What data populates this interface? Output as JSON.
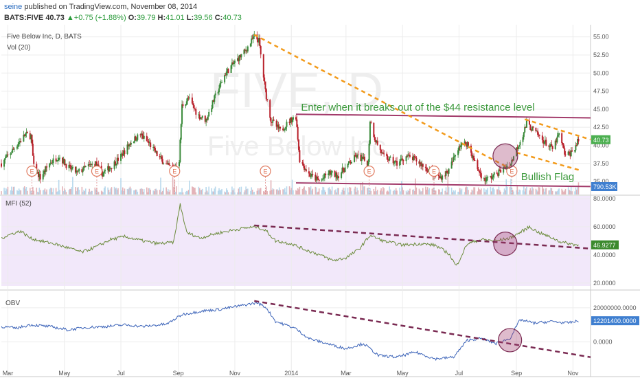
{
  "header": {
    "user": "seine",
    "published_text": "published on TradingView.com, November 08, 2014",
    "symbol": "BATS:FIVE",
    "price": "40.73",
    "change_arrow": "▲",
    "change": "+0.75 (+1.88%)",
    "ohlc": [
      {
        "label": "O:",
        "value": "39.79"
      },
      {
        "label": "H:",
        "value": "41.01"
      },
      {
        "label": "L:",
        "value": "39.56"
      },
      {
        "label": "C:",
        "value": "40.73"
      }
    ]
  },
  "chart_data": [
    {
      "type": "candlestick",
      "title": "Five Below Inc, D, BATS",
      "subtitle": "Vol (20)",
      "watermark": "FIVE, D",
      "watermark_sub": "Five Below Inc",
      "ylim": [
        33.2,
        56.3
      ],
      "y_ticks": [
        "55.00",
        "52.50",
        "50.00",
        "47.50",
        "45.00",
        "42.50",
        "40.00",
        "37.50",
        "35.00"
      ],
      "last_price_label": "40.73",
      "volume_label": "790.53K",
      "earnings_marker": "E",
      "earnings_dates": [
        "2013-03-27",
        "2013-06-05",
        "2013-08-28",
        "2013-12-04",
        "2014-03-26",
        "2014-06-04",
        "2014-08-27"
      ],
      "price_path": [
        [
          "2013-02-22",
          37.5
        ],
        [
          "2013-03-01",
          38.5
        ],
        [
          "2013-03-12",
          40.3
        ],
        [
          "2013-03-20",
          41.5
        ],
        [
          "2013-03-26",
          41.3
        ],
        [
          "2013-03-29",
          37.0
        ],
        [
          "2013-04-05",
          35.5
        ],
        [
          "2013-04-15",
          37.5
        ],
        [
          "2013-04-25",
          38.5
        ],
        [
          "2013-05-05",
          37.0
        ],
        [
          "2013-05-15",
          36.2
        ],
        [
          "2013-05-25",
          37.0
        ],
        [
          "2013-06-04",
          37.5
        ],
        [
          "2013-06-10",
          36.0
        ],
        [
          "2013-06-20",
          37.0
        ],
        [
          "2013-07-01",
          38.5
        ],
        [
          "2013-07-12",
          40.5
        ],
        [
          "2013-07-22",
          41.5
        ],
        [
          "2013-08-01",
          40.2
        ],
        [
          "2013-08-10",
          38.5
        ],
        [
          "2013-08-20",
          37.2
        ],
        [
          "2013-08-27",
          36.8
        ],
        [
          "2013-09-02",
          38.0
        ],
        [
          "2013-09-05",
          45.5
        ],
        [
          "2013-09-12",
          46.5
        ],
        [
          "2013-09-22",
          44.2
        ],
        [
          "2013-10-01",
          43.5
        ],
        [
          "2013-10-10",
          46.5
        ],
        [
          "2013-10-22",
          50.0
        ],
        [
          "2013-11-01",
          51.5
        ],
        [
          "2013-11-12",
          53.0
        ],
        [
          "2013-11-22",
          55.0
        ],
        [
          "2013-11-27",
          54.5
        ],
        [
          "2013-12-04",
          47.5
        ],
        [
          "2013-12-10",
          43.5
        ],
        [
          "2013-12-20",
          42.0
        ],
        [
          "2013-12-31",
          43.5
        ],
        [
          "2014-01-06",
          44.0
        ],
        [
          "2014-01-10",
          38.0
        ],
        [
          "2014-01-20",
          36.0
        ],
        [
          "2014-02-01",
          35.0
        ],
        [
          "2014-02-10",
          36.2
        ],
        [
          "2014-02-20",
          35.8
        ],
        [
          "2014-03-01",
          37.0
        ],
        [
          "2014-03-12",
          38.5
        ],
        [
          "2014-03-20",
          38.0
        ],
        [
          "2014-03-25",
          37.5
        ],
        [
          "2014-03-27",
          43.5
        ],
        [
          "2014-04-01",
          41.0
        ],
        [
          "2014-04-10",
          38.5
        ],
        [
          "2014-04-25",
          37.5
        ],
        [
          "2014-05-05",
          38.5
        ],
        [
          "2014-05-15",
          38.0
        ],
        [
          "2014-05-25",
          37.0
        ],
        [
          "2014-06-04",
          36.0
        ],
        [
          "2014-06-10",
          35.5
        ],
        [
          "2014-06-20",
          36.5
        ],
        [
          "2014-07-01",
          40.0
        ],
        [
          "2014-07-10",
          40.3
        ],
        [
          "2014-07-20",
          37.0
        ],
        [
          "2014-07-28",
          35.2
        ],
        [
          "2014-08-05",
          35.6
        ],
        [
          "2014-08-15",
          36.5
        ],
        [
          "2014-08-26",
          37.5
        ],
        [
          "2014-09-01",
          39.5
        ],
        [
          "2014-09-08",
          41.5
        ],
        [
          "2014-09-12",
          43.0
        ],
        [
          "2014-09-20",
          42.0
        ],
        [
          "2014-10-01",
          40.5
        ],
        [
          "2014-10-10",
          39.5
        ],
        [
          "2014-10-17",
          41.5
        ],
        [
          "2014-10-24",
          38.5
        ],
        [
          "2014-11-01",
          39.2
        ],
        [
          "2014-11-07",
          40.73
        ]
      ],
      "annotations": [
        {
          "text": "Enter when it breaks out of the $44 resistance level",
          "x": "2014-02-25",
          "y": 44.8
        },
        {
          "text": "Bullish Flag",
          "x": "2014-09-05",
          "y": 35.2
        }
      ],
      "lines": [
        {
          "name": "resistance",
          "color": "#a23a6a",
          "style": "solid",
          "points": [
            [
              "2014-01-06",
              44.3
            ],
            [
              "2014-11-20",
              43.8
            ]
          ]
        },
        {
          "name": "support",
          "color": "#a23a6a",
          "style": "solid",
          "points": [
            [
              "2014-01-06",
              34.8
            ],
            [
              "2014-11-20",
              34.3
            ]
          ]
        },
        {
          "name": "downtrend",
          "color": "#f29a1a",
          "style": "dashed",
          "points": [
            [
              "2013-11-22",
              55.3
            ],
            [
              "2014-08-25",
              36.8
            ]
          ]
        },
        {
          "name": "flag-upper",
          "color": "#f29a1a",
          "style": "dashed",
          "points": [
            [
              "2014-09-10",
              43.6
            ],
            [
              "2014-11-20",
              40.8
            ]
          ]
        },
        {
          "name": "flag-lower",
          "color": "#f29a1a",
          "style": "dashed",
          "points": [
            [
              "2014-09-01",
              39.0
            ],
            [
              "2014-11-10",
              36.5
            ]
          ]
        }
      ],
      "circle": {
        "x": "2014-08-20",
        "y": 38.5
      }
    },
    {
      "type": "line",
      "title": "MFI (52)",
      "ylim": [
        18,
        82
      ],
      "y_ticks": [
        "80.0000",
        "60.0000",
        "40.0000",
        "20.0000"
      ],
      "last_value_label": "46.9277",
      "values": [
        [
          "2013-02-22",
          52
        ],
        [
          "2013-03-05",
          55
        ],
        [
          "2013-03-15",
          57
        ],
        [
          "2013-03-25",
          52
        ],
        [
          "2013-04-05",
          50
        ],
        [
          "2013-04-20",
          48
        ],
        [
          "2013-05-05",
          45
        ],
        [
          "2013-05-20",
          42
        ],
        [
          "2013-06-05",
          46
        ],
        [
          "2013-06-20",
          51
        ],
        [
          "2013-07-05",
          53
        ],
        [
          "2013-07-25",
          50
        ],
        [
          "2013-08-10",
          48
        ],
        [
          "2013-08-27",
          49
        ],
        [
          "2013-09-03",
          76
        ],
        [
          "2013-09-10",
          56
        ],
        [
          "2013-09-25",
          52
        ],
        [
          "2013-10-10",
          55
        ],
        [
          "2013-10-25",
          57
        ],
        [
          "2013-11-10",
          59
        ],
        [
          "2013-11-25",
          60
        ],
        [
          "2013-12-05",
          57
        ],
        [
          "2013-12-15",
          50
        ],
        [
          "2014-01-01",
          48
        ],
        [
          "2014-01-15",
          44
        ],
        [
          "2014-02-01",
          40
        ],
        [
          "2014-02-15",
          36
        ],
        [
          "2014-03-01",
          38
        ],
        [
          "2014-03-15",
          44
        ],
        [
          "2014-03-27",
          54
        ],
        [
          "2014-04-10",
          50
        ],
        [
          "2014-05-01",
          47
        ],
        [
          "2014-05-20",
          48
        ],
        [
          "2014-06-05",
          47
        ],
        [
          "2014-06-20",
          41
        ],
        [
          "2014-06-28",
          32
        ],
        [
          "2014-07-10",
          48
        ],
        [
          "2014-07-25",
          51
        ],
        [
          "2014-08-10",
          50
        ],
        [
          "2014-08-25",
          52
        ],
        [
          "2014-09-05",
          56
        ],
        [
          "2014-09-15",
          60
        ],
        [
          "2014-09-25",
          56
        ],
        [
          "2014-10-10",
          52
        ],
        [
          "2014-10-20",
          49
        ],
        [
          "2014-11-07",
          46.93
        ]
      ],
      "lines": [
        {
          "name": "mfi-trend",
          "color": "#7a2a52",
          "style": "dashed",
          "points": [
            [
              "2013-11-22",
              61
            ],
            [
              "2014-11-20",
              44.5
            ]
          ]
        }
      ],
      "circle": {
        "x": "2014-08-20",
        "y": 48
      }
    },
    {
      "type": "line",
      "title": "OBV",
      "ylim": [
        -18000000,
        28000000
      ],
      "y_ticks": [
        "20000000.0000",
        "0.0000"
      ],
      "last_value_label": "12201400.0000",
      "values": [
        [
          "2013-02-22",
          9000000
        ],
        [
          "2013-03-10",
          8000000
        ],
        [
          "2013-03-25",
          10000000
        ],
        [
          "2013-04-15",
          9000000
        ],
        [
          "2013-05-05",
          7000000
        ],
        [
          "2013-05-25",
          8500000
        ],
        [
          "2013-06-15",
          9000000
        ],
        [
          "2013-07-05",
          10000000
        ],
        [
          "2013-07-25",
          9000000
        ],
        [
          "2013-08-20",
          10500000
        ],
        [
          "2013-09-05",
          16000000
        ],
        [
          "2013-09-25",
          18000000
        ],
        [
          "2013-10-15",
          19000000
        ],
        [
          "2013-11-05",
          21000000
        ],
        [
          "2013-11-25",
          23000000
        ],
        [
          "2013-12-05",
          20000000
        ],
        [
          "2013-12-15",
          12000000
        ],
        [
          "2014-01-05",
          8000000
        ],
        [
          "2014-01-20",
          2000000
        ],
        [
          "2014-02-15",
          -2000000
        ],
        [
          "2014-03-01",
          -4000000
        ],
        [
          "2014-03-20",
          -1000000
        ],
        [
          "2014-04-05",
          -8000000
        ],
        [
          "2014-04-25",
          -9000000
        ],
        [
          "2014-05-15",
          -6000000
        ],
        [
          "2014-06-05",
          -10000000
        ],
        [
          "2014-06-25",
          -9000000
        ],
        [
          "2014-07-10",
          1000000
        ],
        [
          "2014-07-25",
          2000000
        ],
        [
          "2014-08-10",
          -1000000
        ],
        [
          "2014-08-25",
          2000000
        ],
        [
          "2014-09-05",
          13000000
        ],
        [
          "2014-09-20",
          11000000
        ],
        [
          "2014-10-10",
          12000000
        ],
        [
          "2014-10-25",
          11000000
        ],
        [
          "2014-11-07",
          12201400
        ]
      ],
      "lines": [
        {
          "name": "obv-trend",
          "color": "#7a2a52",
          "style": "dashed",
          "points": [
            [
              "2013-11-22",
              24000000
            ],
            [
              "2014-11-20",
              -9000000
            ]
          ]
        }
      ],
      "circle": {
        "x": "2014-08-25",
        "y": 1000000
      }
    }
  ],
  "x_axis": {
    "labels": [
      {
        "text": "Mar",
        "date": "2013-03-01"
      },
      {
        "text": "May",
        "date": "2013-05-01"
      },
      {
        "text": "Jul",
        "date": "2013-07-01"
      },
      {
        "text": "Sep",
        "date": "2013-09-01"
      },
      {
        "text": "Nov",
        "date": "2013-11-01"
      },
      {
        "text": "2014",
        "date": "2014-01-01"
      },
      {
        "text": "Mar",
        "date": "2014-03-01"
      },
      {
        "text": "May",
        "date": "2014-05-01"
      },
      {
        "text": "Jul",
        "date": "2014-07-01"
      },
      {
        "text": "Sep",
        "date": "2014-09-01"
      },
      {
        "text": "Nov",
        "date": "2014-11-01"
      }
    ],
    "range": [
      "2013-02-22",
      "2014-11-20"
    ]
  },
  "colors": {
    "up": "#3a8a3a",
    "down": "#b8202a",
    "mfi_bg": "#f2e8fa",
    "price_badge": "#4caf50",
    "volume_badge": "#3f7fd0",
    "mfi_badge": "#3c8a2e",
    "obv_badge": "#3f7fd0",
    "annotation": "#3d9a3d"
  }
}
